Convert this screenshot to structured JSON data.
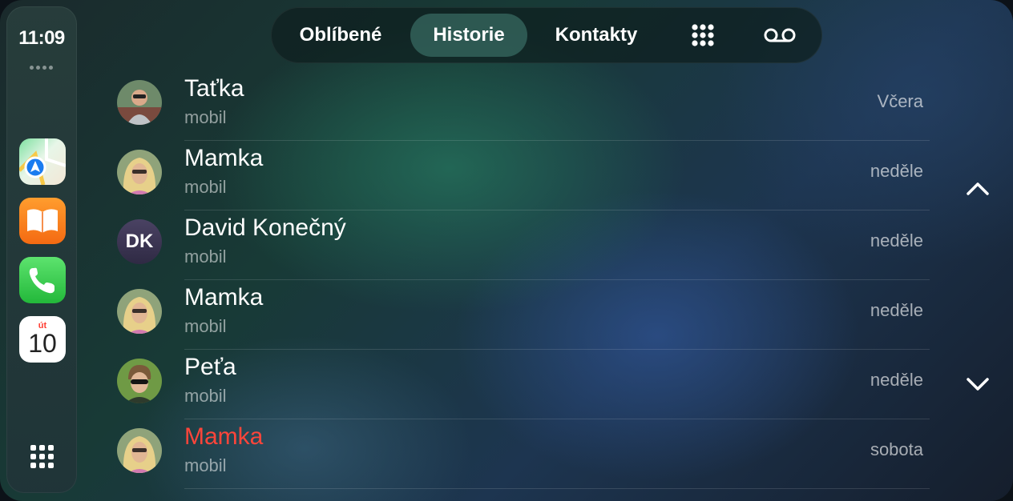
{
  "status": {
    "time": "11:09"
  },
  "dock": {
    "apps": [
      {
        "name": "Maps",
        "icon": "maps-icon"
      },
      {
        "name": "Books",
        "icon": "books-icon"
      },
      {
        "name": "Phone",
        "icon": "phone-icon"
      },
      {
        "name": "Calendar",
        "icon": "calendar-icon",
        "day_label": "út",
        "day_number": "10"
      }
    ],
    "grid_icon": "app-grid-icon"
  },
  "tabs": {
    "favorites": "Oblíbené",
    "history": "Historie",
    "contacts": "Kontakty",
    "keypad_icon": "keypad-icon",
    "voicemail_icon": "voicemail-icon",
    "active": "history"
  },
  "calls": [
    {
      "name": "Taťka",
      "type": "mobil",
      "when": "Včera",
      "avatar": "photo",
      "missed": false
    },
    {
      "name": "Mamka",
      "type": "mobil",
      "when": "neděle",
      "avatar": "photo",
      "missed": false
    },
    {
      "name": "David Konečný",
      "type": "mobil",
      "when": "neděle",
      "avatar": "initials",
      "initials": "DK",
      "missed": false
    },
    {
      "name": "Mamka",
      "type": "mobil",
      "when": "neděle",
      "avatar": "photo",
      "missed": false
    },
    {
      "name": "Peťa",
      "type": "mobil",
      "when": "neděle",
      "avatar": "photo",
      "missed": false
    },
    {
      "name": "Mamka",
      "type": "mobil",
      "when": "sobota",
      "avatar": "photo",
      "missed": true
    }
  ],
  "scroll": {
    "up_icon": "chevron-up-icon",
    "down_icon": "chevron-down-icon"
  },
  "colors": {
    "missed": "#ff453a",
    "active_tab": "#3f7a70"
  }
}
